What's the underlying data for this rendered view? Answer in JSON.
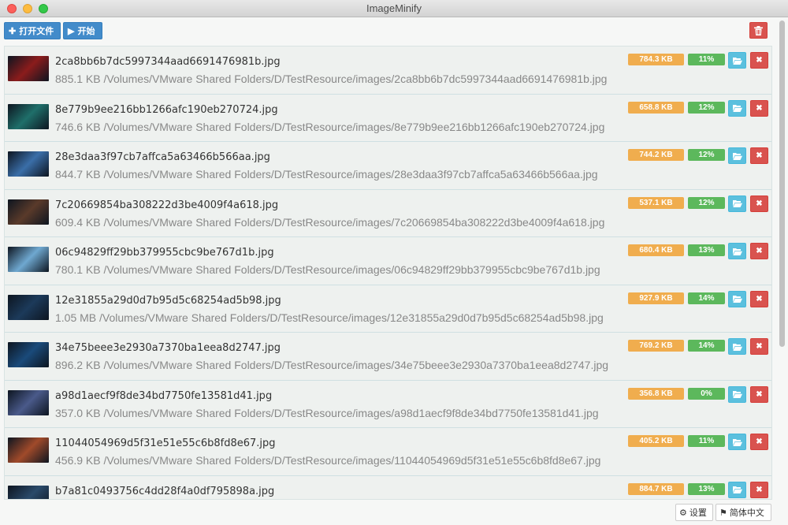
{
  "window": {
    "title": "ImageMinify"
  },
  "toolbar": {
    "open_label": "打开文件",
    "open_icon": "plus-icon",
    "start_label": "开始",
    "start_icon": "play-icon",
    "clear_icon": "trash-icon"
  },
  "files": [
    {
      "name": "2ca8bb6b7dc5997344aad6691476981b.jpg",
      "path": "885.1 KB /Volumes/VMware Shared Folders/D/TestResource/images/2ca8bb6b7dc5997344aad6691476981b.jpg",
      "new_size": "784.3 KB",
      "saved": "11%",
      "thumb": "#8b1c1c"
    },
    {
      "name": "8e779b9ee216bb1266afc190eb270724.jpg",
      "path": "746.6 KB /Volumes/VMware Shared Folders/D/TestResource/images/8e779b9ee216bb1266afc190eb270724.jpg",
      "new_size": "658.8 KB",
      "saved": "12%",
      "thumb": "#1f6f6a"
    },
    {
      "name": "28e3daa3f97cb7affca5a63466b566aa.jpg",
      "path": "844.7 KB /Volumes/VMware Shared Folders/D/TestResource/images/28e3daa3f97cb7affca5a63466b566aa.jpg",
      "new_size": "744.2 KB",
      "saved": "12%",
      "thumb": "#3a6ea8"
    },
    {
      "name": "7c20669854ba308222d3be4009f4a618.jpg",
      "path": "609.4 KB /Volumes/VMware Shared Folders/D/TestResource/images/7c20669854ba308222d3be4009f4a618.jpg",
      "new_size": "537.1 KB",
      "saved": "12%",
      "thumb": "#5a3a2a"
    },
    {
      "name": "06c94829ff29bb379955cbc9be767d1b.jpg",
      "path": "780.1 KB /Volumes/VMware Shared Folders/D/TestResource/images/06c94829ff29bb379955cbc9be767d1b.jpg",
      "new_size": "680.4 KB",
      "saved": "13%",
      "thumb": "#6fa8d0"
    },
    {
      "name": "12e31855a29d0d7b95d5c68254ad5b98.jpg",
      "path": "1.05 MB /Volumes/VMware Shared Folders/D/TestResource/images/12e31855a29d0d7b95d5c68254ad5b98.jpg",
      "new_size": "927.9 KB",
      "saved": "14%",
      "thumb": "#1c3a5a"
    },
    {
      "name": "34e75beee3e2930a7370ba1eea8d2747.jpg",
      "path": "896.2 KB /Volumes/VMware Shared Folders/D/TestResource/images/34e75beee3e2930a7370ba1eea8d2747.jpg",
      "new_size": "769.2 KB",
      "saved": "14%",
      "thumb": "#1a4a7a"
    },
    {
      "name": "a98d1aecf9f8de34bd7750fe13581d41.jpg",
      "path": "357.0 KB /Volumes/VMware Shared Folders/D/TestResource/images/a98d1aecf9f8de34bd7750fe13581d41.jpg",
      "new_size": "356.8 KB",
      "saved": "0%",
      "thumb": "#4a5a8a"
    },
    {
      "name": "11044054969d5f31e51e55c6b8fd8e67.jpg",
      "path": "456.9 KB /Volumes/VMware Shared Folders/D/TestResource/images/11044054969d5f31e51e55c6b8fd8e67.jpg",
      "new_size": "405.2 KB",
      "saved": "11%",
      "thumb": "#a04a2a"
    },
    {
      "name": "b7a81c0493756c4dd28f4a0df795898a.jpg",
      "path": "",
      "new_size": "884.7 KB",
      "saved": "13%",
      "thumb": "#2a4a6a"
    }
  ],
  "footer": {
    "settings_label": "设置",
    "settings_icon": "gear-icon",
    "lang_label": "简体中文",
    "lang_icon": "flag-icon"
  },
  "colors": {
    "primary": "#428bca",
    "danger": "#d9534f",
    "warning": "#f0ad4e",
    "success": "#5cb85c",
    "info": "#5bc0de"
  }
}
